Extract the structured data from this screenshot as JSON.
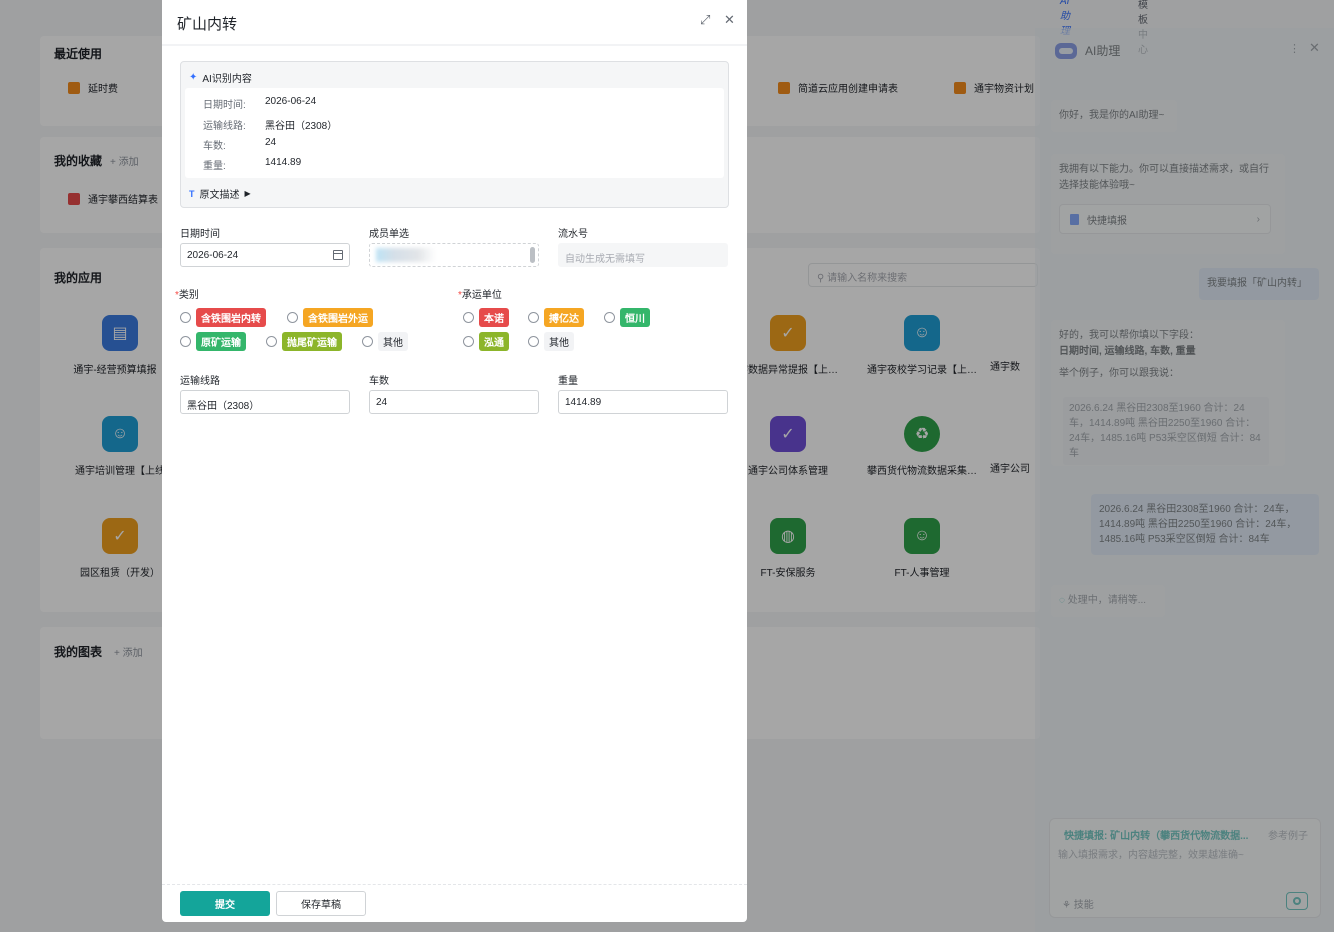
{
  "topbar": {
    "ai_label": "AI助理",
    "template_label": "模板中心"
  },
  "dashboard": {
    "recent": {
      "title": "最近使用",
      "items": [
        "延时费",
        "简道云应用创建申请表",
        "通宇物资计划"
      ]
    },
    "favorites": {
      "title": "我的收藏",
      "add": "添加",
      "items": [
        "通宇攀西结算表"
      ]
    },
    "apps": {
      "title": "我的应用",
      "search_placeholder": "请输入名称来搜索",
      "items": [
        {
          "label": "通宇-经营预算填报【",
          "color": "#3b7be0"
        },
        {
          "label": "宇数据异常提报【上…",
          "color": "#f0a020"
        },
        {
          "label": "通宇夜校学习记录【上…",
          "color": "#1f9fd6"
        },
        {
          "label": "通宇数",
          "color": "#1f9fd6"
        },
        {
          "label": "通宇培训管理【上线",
          "color": "#1f9fd6"
        },
        {
          "label": "通宇公司体系管理",
          "color": "#6f4fd8"
        },
        {
          "label": "攀西货代物流数据采集…",
          "color": "#2fa24a"
        },
        {
          "label": "通宇公司",
          "color": "#1f9fd6"
        },
        {
          "label": "园区租赁（开发）",
          "color": "#f0a020"
        },
        {
          "label": "FT-安保服务",
          "color": "#2fa24a"
        },
        {
          "label": "FT-人事管理",
          "color": "#2fa24a"
        }
      ]
    },
    "charts": {
      "title": "我的图表",
      "add": "添加"
    }
  },
  "modal": {
    "title": "矿山内转",
    "ai_box": {
      "header": "AI识别内容",
      "rows": [
        {
          "label": "日期时间:",
          "value": "2026-06-24"
        },
        {
          "label": "运输线路:",
          "value": "黑谷田（2308）"
        },
        {
          "label": "车数:",
          "value": "24"
        },
        {
          "label": "重量:",
          "value": "1414.89"
        }
      ],
      "raw_toggle": "原文描述"
    },
    "fields": {
      "date": {
        "label": "日期时间",
        "value": "2026-06-24"
      },
      "member": {
        "label": "成员单选"
      },
      "serial": {
        "label": "流水号",
        "placeholder": "自动生成无需填写"
      },
      "category": {
        "label": "类别",
        "options": [
          {
            "label": "含铁围岩内转",
            "color": "#e64b4b"
          },
          {
            "label": "含铁围岩外运",
            "color": "#f5a623"
          },
          {
            "label": "原矿运输",
            "color": "#34b66b"
          },
          {
            "label": "抛尾矿运输",
            "color": "#8cb52a"
          },
          {
            "label": "其他",
            "color": ""
          }
        ]
      },
      "carrier": {
        "label": "承运单位",
        "options": [
          {
            "label": "本诺",
            "color": "#e64b4b"
          },
          {
            "label": "搏亿达",
            "color": "#f5a623"
          },
          {
            "label": "恒川",
            "color": "#34b66b"
          },
          {
            "label": "泓通",
            "color": "#8cb52a"
          },
          {
            "label": "其他",
            "color": ""
          }
        ]
      },
      "route": {
        "label": "运输线路",
        "value": "黑谷田（2308）"
      },
      "cars": {
        "label": "车数",
        "value": "24"
      },
      "weight": {
        "label": "重量",
        "value": "1414.89"
      }
    },
    "submit": "提交",
    "save_draft": "保存草稿"
  },
  "assistant": {
    "title": "AI助理",
    "greeting": "你好，我是你的AI助理~",
    "capability": "我拥有以下能力。你可以直接描述需求，或自行选择技能体验哦~",
    "quick_fill": "快捷填报",
    "user_msg1": "我要填报「矿山内转」",
    "reply_line1": "好的，我可以帮你填以下字段：",
    "reply_line2": "日期时间, 运输线路, 车数, 重量",
    "reply_line3": "举个例子，你可以跟我说：",
    "example": "2026.6.24 黑谷田2308至1960 合计：24车，1414.89吨 黑谷田2250至1960 合计：24车，1485.16吨 P53采空区倒短 合计：84车",
    "user_msg2": "2026.6.24 黑谷田2308至1960 合计：24车，1414.89吨 黑谷田2250至1960 合计：24车，1485.16吨 P53采空区倒短 合计：84车",
    "processing": "处理中，请稍等...",
    "input": {
      "title": "快捷填报: 矿山内转（攀西货代物流数据...",
      "ref": "参考例子",
      "placeholder": "输入填报需求，内容越完整，效果越准确~",
      "skill": "技能"
    }
  }
}
